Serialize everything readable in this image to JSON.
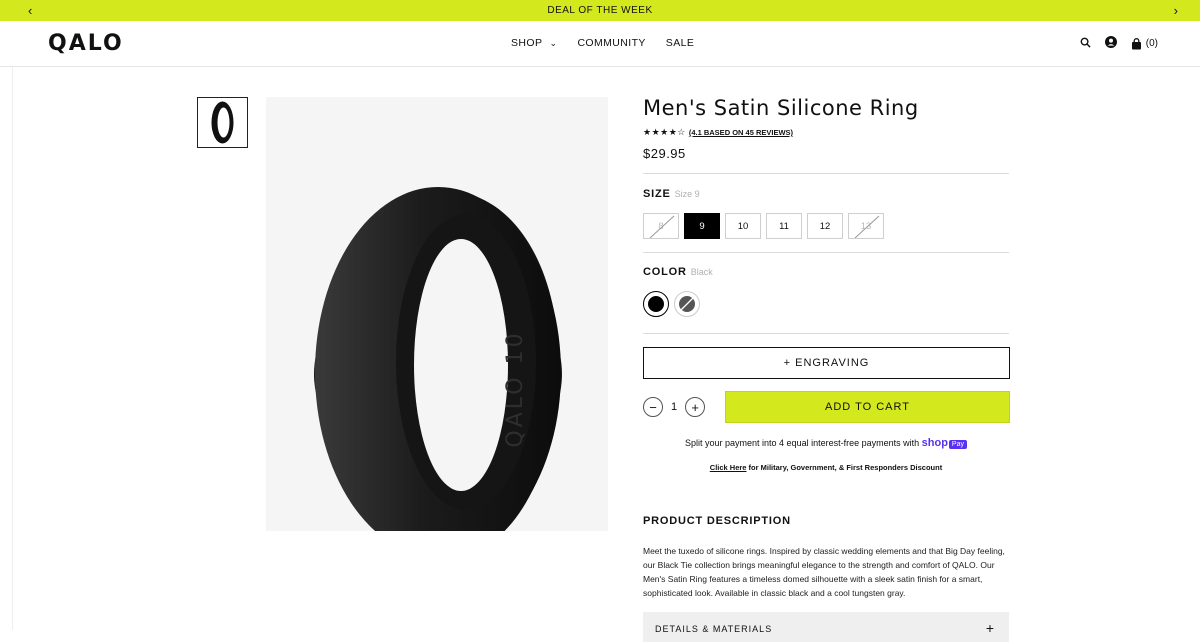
{
  "promo": {
    "text": "DEAL OF THE WEEK",
    "prev": "‹",
    "next": "›",
    "bg": "#d4e81e"
  },
  "header": {
    "logo": "QALO",
    "nav": [
      {
        "label": "SHOP"
      },
      {
        "label": "COMMUNITY"
      },
      {
        "label": "SALE"
      }
    ],
    "cart_count": "(0)",
    "icons": [
      "search-icon",
      "account-icon",
      "bag-icon"
    ]
  },
  "product": {
    "title": "Men's Satin Silicone Ring",
    "rating_stars": "★★★★☆",
    "rating_text": "(4.1 BASED ON 45 REVIEWS)",
    "price": "$29.95",
    "image_band_text": "QALO 10"
  },
  "size": {
    "label": "SIZE",
    "selected": "Size 9",
    "options": [
      {
        "label": "8",
        "state": "disabled"
      },
      {
        "label": "9",
        "state": "selected"
      },
      {
        "label": "10",
        "state": "available"
      },
      {
        "label": "11",
        "state": "available"
      },
      {
        "label": "12",
        "state": "available"
      },
      {
        "label": "13",
        "state": "disabled"
      }
    ]
  },
  "color": {
    "label": "COLOR",
    "selected": "Black",
    "options": [
      {
        "name": "Black",
        "hex": "#000000",
        "state": "selected"
      },
      {
        "name": "Tungsten Gray",
        "hex": "#555555",
        "state": "disabled"
      }
    ]
  },
  "actions": {
    "engraving": "+ ENGRAVING",
    "quantity": "1",
    "minus": "−",
    "plus": "+",
    "add_to_cart": "ADD TO CART"
  },
  "payment": {
    "split_text": "Split your payment into 4 equal interest-free payments with",
    "shop_text": "shop",
    "pay_text": "Pay"
  },
  "discount": {
    "link": "Click Here",
    "text": " for Military, Government, & First Responders Discount"
  },
  "description": {
    "heading": "PRODUCT DESCRIPTION",
    "body": "Meet the tuxedo of silicone rings. Inspired by classic wedding elements and that Big Day feeling, our Black Tie collection brings meaningful elegance to the strength and comfort of QALO. Our Men's Satin Ring features a timeless domed silhouette with a sleek satin finish for a smart, sophisticated look. Available in classic black and a cool tungsten gray.",
    "details_label": "DETAILS & MATERIALS",
    "details_toggle": "+"
  }
}
